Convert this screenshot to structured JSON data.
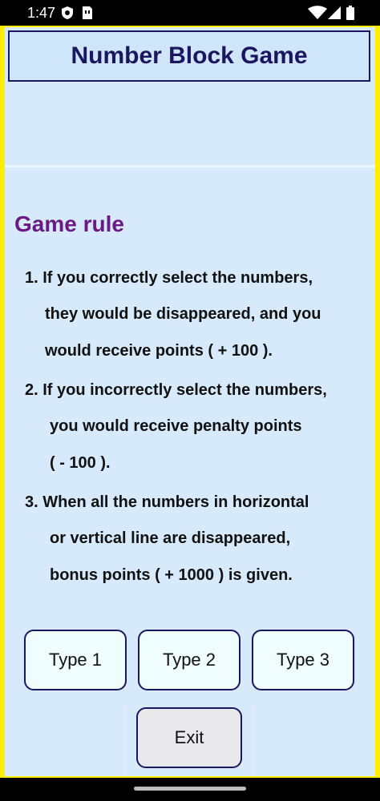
{
  "status_bar": {
    "time": "1:47",
    "icons": [
      "shield-icon",
      "sim-card-icon",
      "wifi-icon",
      "cellular-signal-icon",
      "battery-icon"
    ]
  },
  "app": {
    "title": "Number Block Game",
    "rule_heading": "Game rule",
    "rules": [
      {
        "lines": [
          "1.  If you correctly select the numbers,",
          "they would be disappeared, and you",
          "would receive points ( + 100 )."
        ]
      },
      {
        "lines": [
          "2.  If you incorrectly select the numbers,",
          "you would receive penalty points",
          "( - 100 )."
        ]
      },
      {
        "lines": [
          "3.  When all the numbers in horizontal",
          "or vertical line are disappeared,",
          "bonus points ( + 1000 ) is given."
        ]
      }
    ],
    "buttons": {
      "type1": "Type 1",
      "type2": "Type 2",
      "type3": "Type 3",
      "exit": "Exit"
    }
  },
  "colors": {
    "frame": "#ffee00",
    "background": "#d6eafc",
    "title_color": "#1a1660",
    "heading_color": "#6b1a84"
  }
}
